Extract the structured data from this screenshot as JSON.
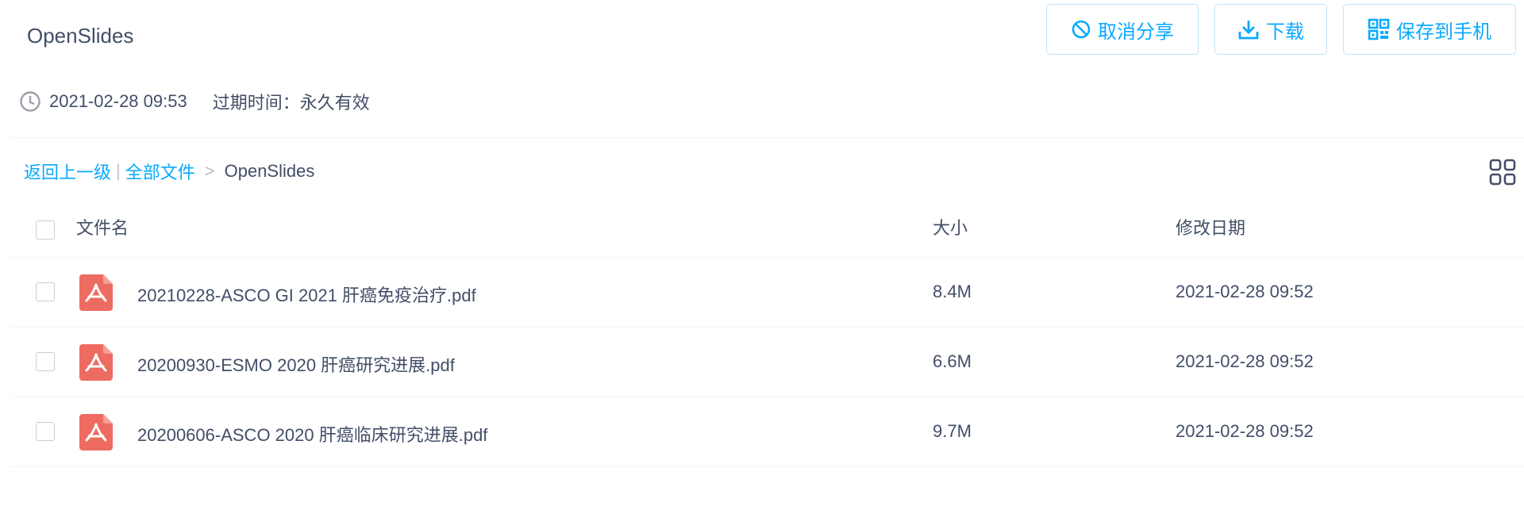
{
  "share": {
    "title": "OpenSlides",
    "created_at": "2021-02-28 09:53",
    "expire_label": "过期时间：永久有效"
  },
  "actions": {
    "cancel_share": "取消分享",
    "download": "下载",
    "save_to_phone": "保存到手机"
  },
  "breadcrumb": {
    "back": "返回上一级",
    "separator": "|",
    "all_files": "全部文件",
    "arrow": ">",
    "current": "OpenSlides"
  },
  "table": {
    "columns": {
      "name": "文件名",
      "size": "大小",
      "modified": "修改日期"
    },
    "rows": [
      {
        "name": "20210228-ASCO GI 2021 肝癌免疫治疗.pdf",
        "size": "8.4M",
        "modified": "2021-02-28 09:52",
        "icon": "pdf-icon"
      },
      {
        "name": "20200930-ESMO 2020 肝癌研究进展.pdf",
        "size": "6.6M",
        "modified": "2021-02-28 09:52",
        "icon": "pdf-icon"
      },
      {
        "name": "20200606-ASCO 2020 肝癌临床研究进展.pdf",
        "size": "9.7M",
        "modified": "2021-02-28 09:52",
        "icon": "pdf-icon"
      }
    ]
  },
  "colors": {
    "accent": "#09aaff",
    "text": "#424e67",
    "pdf_red": "#ee6b61",
    "button_border": "#c3e3f7"
  },
  "icons": {
    "cancel": "ban-icon",
    "download": "download-icon",
    "save": "qrcode-icon",
    "time": "clock-icon",
    "view_toggle": "grid-view-icon"
  }
}
